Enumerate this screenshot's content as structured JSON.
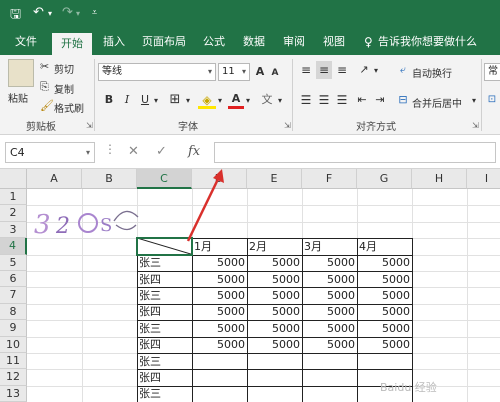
{
  "colors": {
    "accent": "#217346",
    "arrow": "#d9302c"
  },
  "tabs": [
    {
      "label": "文件",
      "active": false
    },
    {
      "label": "开始",
      "active": true
    },
    {
      "label": "插入",
      "active": false
    },
    {
      "label": "页面布局",
      "active": false
    },
    {
      "label": "公式",
      "active": false
    },
    {
      "label": "数据",
      "active": false
    },
    {
      "label": "审阅",
      "active": false
    },
    {
      "label": "视图",
      "active": false
    }
  ],
  "tell_me": "告诉我你想要做什么",
  "clipboard": {
    "paste": "粘贴",
    "cut": "剪切",
    "copy": "复制",
    "format_painter": "格式刷",
    "group": "剪贴板"
  },
  "font": {
    "name": "等线",
    "size": "11",
    "grow": "A",
    "shrink": "A",
    "bold": "B",
    "italic": "I",
    "underline": "U",
    "group": "字体"
  },
  "alignment": {
    "wrap": "自动换行",
    "merge": "合并后居中",
    "group": "对齐方式"
  },
  "number_partial": "常",
  "formula_bar": {
    "name_box": "C4",
    "cancel": "✕",
    "enter": "✓",
    "fx": "fx",
    "value": ""
  },
  "columns": [
    "A",
    "B",
    "C",
    "D",
    "E",
    "F",
    "G",
    "H",
    "I"
  ],
  "rows": [
    "1",
    "2",
    "3",
    "4",
    "5",
    "6",
    "7",
    "8",
    "9",
    "10",
    "11",
    "12",
    "13"
  ],
  "header_row": [
    "1月",
    "2月",
    "3月",
    "4月"
  ],
  "names": [
    "张三",
    "张四",
    "张三",
    "张四",
    "张三",
    "张四",
    "张三",
    "张四",
    "张三"
  ],
  "values": [
    [
      5000,
      5000,
      5000,
      5000
    ],
    [
      5000,
      5000,
      5000,
      5000
    ],
    [
      5000,
      5000,
      5000,
      5000
    ],
    [
      5000,
      5000,
      5000,
      5000
    ],
    [
      5000,
      5000,
      5000,
      5000
    ],
    [
      5000,
      5000,
      5000,
      5000
    ]
  ]
}
